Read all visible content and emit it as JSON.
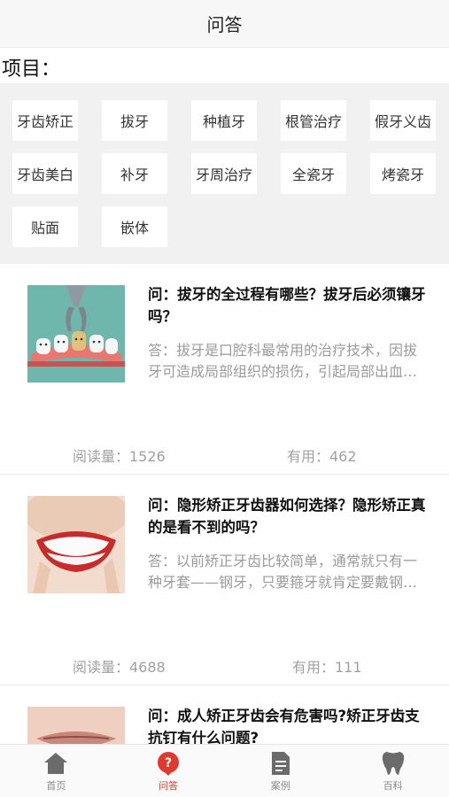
{
  "header": {
    "title": "问答"
  },
  "project": {
    "label": "项目：",
    "tags": [
      "牙齿矫正",
      "拔牙",
      "种植牙",
      "根管治疗",
      "假牙义齿",
      "牙齿美白",
      "补牙",
      "牙周治疗",
      "全瓷牙",
      "烤瓷牙",
      "贴面",
      "嵌体"
    ]
  },
  "qa_list": [
    {
      "question": "问：拔牙的全过程有哪些？拔牙后必须镶牙吗？",
      "answer": "答：拔牙是口腔科最常用的治疗技术，因拔牙可造成局部组织的损伤，引起局部出血、疼痛等。",
      "reads": "阅读量：1526",
      "useful": "有用：462",
      "image": "tooth-extraction-illustration"
    },
    {
      "question": "问：隐形矫正牙齿器如何选择？隐形矫正真的是看不到的吗？",
      "answer": "答：以前矫正牙齿比较简单，通常就只有一种牙套——钢牙，只要箍牙就肯定要戴钢牙。",
      "reads": "阅读量：4688",
      "useful": "有用：111",
      "image": "smile-aligner-photo"
    },
    {
      "question": "问：成人矫正牙齿会有危害吗?矫正牙齿支抗钉有什么问题?",
      "answer": "",
      "reads": "",
      "useful": "",
      "image": "lips-photo"
    }
  ],
  "tabbar": {
    "items": [
      {
        "label": "首页",
        "icon": "home-icon",
        "active": false
      },
      {
        "label": "问答",
        "icon": "question-icon",
        "active": true
      },
      {
        "label": "案例",
        "icon": "document-icon",
        "active": false
      },
      {
        "label": "百科",
        "icon": "tooth-icon",
        "active": false
      }
    ]
  },
  "colors": {
    "accent": "#e03a2f",
    "muted": "#9a9a9a",
    "panel": "#f1f1f1"
  }
}
